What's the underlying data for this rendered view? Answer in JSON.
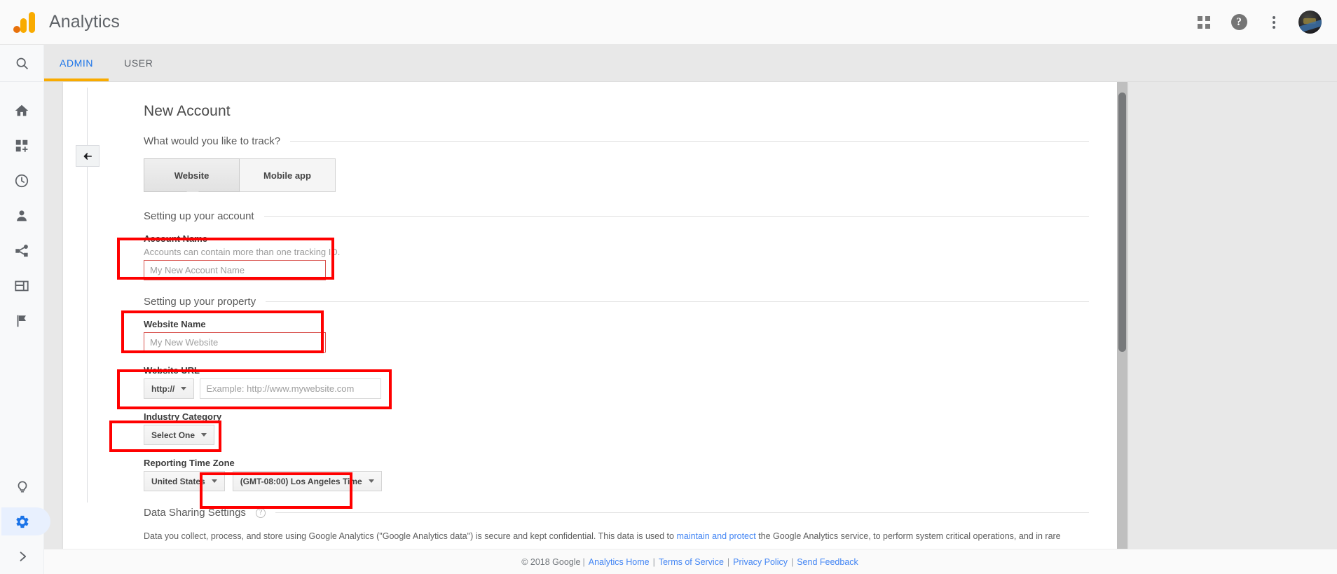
{
  "header": {
    "app_title": "Analytics",
    "logo_icon": "google-analytics-logo",
    "icons": [
      {
        "name": "apps-grid-icon",
        "label": "Google apps"
      },
      {
        "name": "help-icon",
        "label": "?"
      },
      {
        "name": "more-vert-icon",
        "label": "More options"
      },
      {
        "name": "avatar-icon",
        "label": "Account"
      }
    ]
  },
  "sidebar": {
    "search": {
      "icon": "search-icon",
      "label": "Search"
    },
    "items": [
      {
        "icon": "home-icon",
        "label": "Home"
      },
      {
        "icon": "customization-icon",
        "label": "Customization"
      },
      {
        "icon": "realtime-clock-icon",
        "label": "Realtime"
      },
      {
        "icon": "audience-person-icon",
        "label": "Audience"
      },
      {
        "icon": "acquisition-share-icon",
        "label": "Acquisition"
      },
      {
        "icon": "behavior-window-icon",
        "label": "Behavior"
      },
      {
        "icon": "conversions-flag-icon",
        "label": "Conversions"
      }
    ],
    "bottom_items": [
      {
        "icon": "discover-bulb-icon",
        "label": "Discover",
        "active": false
      },
      {
        "icon": "admin-gear-icon",
        "label": "Admin",
        "active": true
      },
      {
        "icon": "chevron-right-icon",
        "label": "Expand",
        "active": false
      }
    ]
  },
  "tabs": [
    {
      "label": "ADMIN",
      "active": true
    },
    {
      "label": "USER",
      "active": false
    }
  ],
  "collapse": {
    "icon": "arrow-left-icon",
    "label": "Collapse panel"
  },
  "main": {
    "page_title": "New Account",
    "track_section": {
      "label": "What would you like to track?",
      "options": [
        {
          "label": "Website",
          "selected": true
        },
        {
          "label": "Mobile app",
          "selected": false
        }
      ]
    },
    "account_section": {
      "label": "Setting up your account",
      "account_name": {
        "label": "Account Name",
        "hint": "Accounts can contain more than one tracking ID.",
        "placeholder": "My New Account Name",
        "value": ""
      }
    },
    "property_section": {
      "label": "Setting up your property",
      "website_name": {
        "label": "Website Name",
        "placeholder": "My New Website",
        "value": ""
      },
      "website_url": {
        "label": "Website URL",
        "protocol": "http://",
        "placeholder": "Example: http://www.mywebsite.com",
        "value": ""
      },
      "industry_category": {
        "label": "Industry Category",
        "selected": "Select One"
      },
      "time_zone": {
        "label": "Reporting Time Zone",
        "country": "United States",
        "zone": "(GMT-08:00) Los Angeles Time"
      }
    },
    "data_sharing": {
      "label": "Data Sharing Settings",
      "help_icon": "help-circle-icon",
      "paragraph_part1": "Data you collect, process, and store using Google Analytics (\"Google Analytics data\") is secure and kept confidential. This data is used to ",
      "link_text": "maintain and protect",
      "paragraph_part2": " the Google Analytics service, to perform system critical operations, and in rare"
    }
  },
  "footer": {
    "copyright": "© 2018 Google",
    "links": [
      {
        "label": "Analytics Home"
      },
      {
        "label": "Terms of Service"
      },
      {
        "label": "Privacy Policy"
      },
      {
        "label": "Send Feedback"
      }
    ],
    "separator": "|"
  },
  "colors": {
    "accent_blue": "#1a73e8",
    "accent_orange": "#f9ab00",
    "annotation_red": "#ff0000",
    "error_border": "#d9534f"
  }
}
